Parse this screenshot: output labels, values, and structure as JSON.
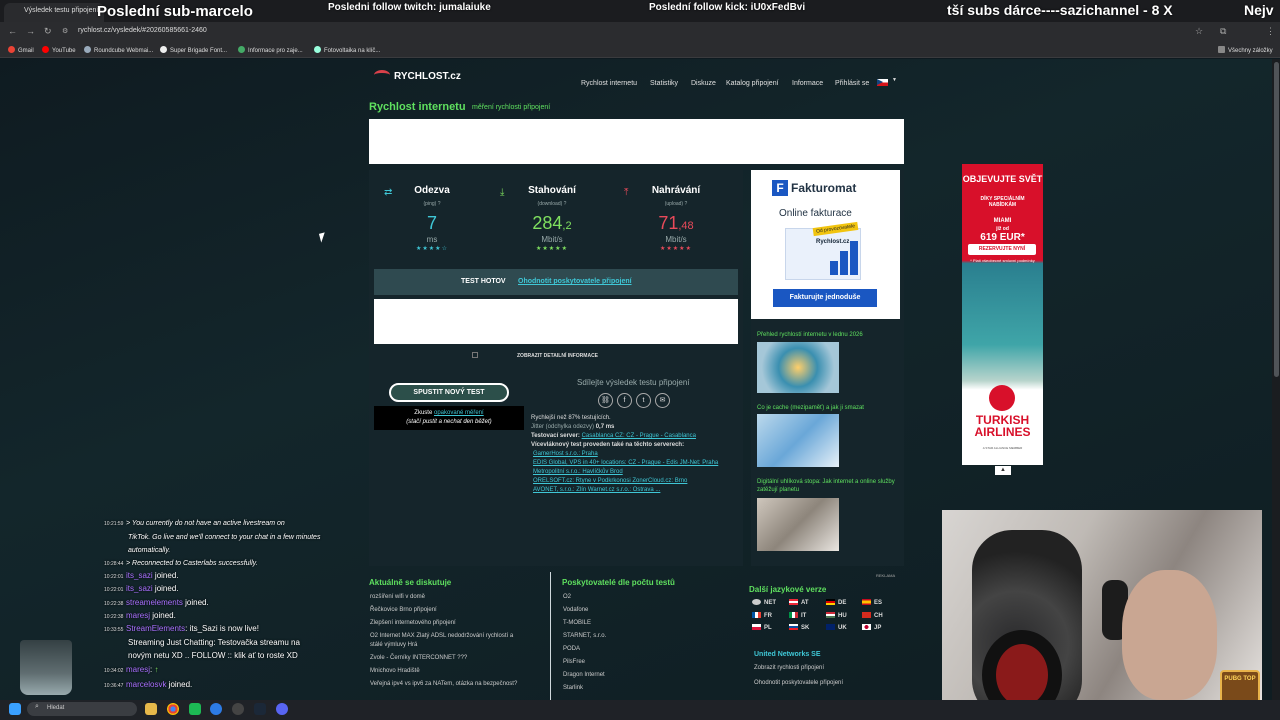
{
  "overlay": {
    "sub_marcel": "Poslední sub-marcelo",
    "follow_twitch": "Posledni follow twitch: jumalaiuke",
    "follow_kick": "Poslední follow kick: iU0xFedBvi",
    "subs_donor": "tší subs dárce----sazichannel - 8 X",
    "right_edge": "Nejv"
  },
  "browser": {
    "tab_title": "Výsledek testu připojení",
    "url": "rychlost.cz/vysledek/#20260585661-2460",
    "bookmarks": [
      "Gmail",
      "YouTube",
      "Roundcube Webmai...",
      "Super Brigade Font...",
      "Informace pro zaje...",
      "Fotovoltaika na klíč..."
    ],
    "all_bookmarks": "Všechny záložky"
  },
  "site": {
    "logo": "RYCHLOST.cz",
    "nav": [
      "Rychlost internetu",
      "Statistiky",
      "Diskuze",
      "Katalog připojení",
      "Informace",
      "Přihlásit se"
    ],
    "title": "Rychlost internetu",
    "subtitle": "měření rychlosti připojení"
  },
  "results": {
    "ping": {
      "label": "Odezva",
      "hint": "(ping) ?",
      "value": "7",
      "unit": "ms"
    },
    "download": {
      "label": "Stahování",
      "hint": "(download) ?",
      "value_int": "284",
      "value_dec": ",2",
      "unit": "Mbit/s"
    },
    "upload": {
      "label": "Nahrávání",
      "hint": "(upload) ?",
      "value_int": "71",
      "value_dec": ",48",
      "unit": "Mbit/s"
    },
    "done_label": "TEST HOTOV",
    "rate_link": "Ohodnotit poskytovatele připojení",
    "detail_label": "ZOBRAZIT DETAILNÍ INFORMACE",
    "new_test": "SPUSTIT NOVÝ TEST",
    "try_prefix": "Zkuste",
    "try_link": "opakované měření",
    "try_note": "(stačí pustit a nechat den běžet)",
    "share": "Sdílejte výsledek testu připojení",
    "faster": "Rychlejší než 87% testujících.",
    "jitter_label": "Jitter (odchylka odezvy)",
    "jitter_value": "0,7 ms",
    "server_label": "Testovací server:",
    "server_value": "Casablanca CZ: CZ - Prague - Casablanca",
    "multi_label": "Vícevláknový test proveden také na těchto serverech:",
    "servers_line1": "GamerHost s.r.o.: Praha",
    "servers_line2": "EDIS Global, VPS in 40+ locations: CZ - Prague - Edis   JM-Net: Praha",
    "servers_line3": "Metropolitní s.r.o.: Havlíčkův Brod",
    "servers_line4": "ORELSOFT.cz: Rtyne v Podkrkonosi   ZonerCloud.cz: Brno",
    "servers_line5": "AVONET, s.r.o.: Zlín   Warnet.cz s.r.o.: Ostrava ..."
  },
  "side": {
    "fk_logo": "Fakturomat",
    "fk_sub": "Online fakturace",
    "fk_tag": "Od provozovatele",
    "fk_chart": "Rychlost.cz",
    "fk_btn": "Fakturujte jednoduše",
    "art1": "Přehled rychlostí internetu v lednu 2026",
    "art2": "Co je cache (mezipaměť) a jak ji smazat",
    "art3": "Digitální uhlíková stopa: Jak internet a online služby zatěžují planetu"
  },
  "ad2": {
    "line1": "OBJEVUJTE SVĚT",
    "line2": "DÍKY SPECIÁLNÍM NABÍDKÁM",
    "city": "MIAMI",
    "from": "již od",
    "price": "619 EUR*",
    "btn": "REZERVUJTE NYNÍ",
    "note": "* Platí všeobecné smluvní podmínky",
    "brand": "TURKISH AIRLINES",
    "tagline": "A STAR ALLIANCE MEMBER"
  },
  "bottom": {
    "disc_title": "Aktuálně se diskutuje",
    "disc": [
      "rozšíření wifi v domě",
      "Řečkovice Brno připojení",
      "Zlepšení internetového připojení",
      "O2 Internet MAX Zlatý ADSL nedodržování rychlostí a",
      "stálé výmluvy Hrá",
      "Zvole - Černíky INTERCONNET ???",
      "Mnichovo Hradiště",
      "Veřejná ipv4 vs ipv6 za NATem, otázka na bezpečnost?"
    ],
    "prov_title": "Poskytovatelé dle počtu testů",
    "prov": [
      "O2",
      "Vodafone",
      "T-MOBILE",
      "STARNET, s.r.o.",
      "PODA",
      "PilsFree",
      "Dragon Internet",
      "Starlink"
    ],
    "lang_title": "Další jazykové verze",
    "langs": [
      "NET",
      "AT",
      "DE",
      "ES",
      "FR",
      "IT",
      "HU",
      "CH",
      "PL",
      "SK",
      "UK",
      "JP"
    ],
    "reklama": "REKLAMA",
    "un_title": "United Networks SE",
    "un_links": [
      "Zobrazit rychlosti připojení",
      "Ohodnotit poskytovatele připojení"
    ]
  },
  "chat": [
    {
      "time": "10:21:59",
      "user": "",
      "text": "> You currently do not have an active livestream on",
      "italic": true
    },
    {
      "time": "",
      "user": "",
      "text": "TikTok. Go live and we'll connect to your chat in a few minutes",
      "italic": true
    },
    {
      "time": "",
      "user": "",
      "text": "automatically.",
      "italic": true
    },
    {
      "time": "10:28:44",
      "user": "",
      "text": "> Reconnected to Casterlabs successfully.",
      "italic": true
    },
    {
      "time": "10:22:01",
      "user": "its_sazi",
      "text": " joined.",
      "italic": false
    },
    {
      "time": "10:22:01",
      "user": "its_sazi",
      "text": " joined.",
      "italic": false
    },
    {
      "time": "10:22:38",
      "user": "streamelements",
      "text": " joined.",
      "italic": false
    },
    {
      "time": "10:22:38",
      "user": "maresj",
      "text": " joined.",
      "italic": false
    },
    {
      "time": "10:33:55",
      "user": "StreamElements",
      "text": ": its_Sazi is now live!",
      "italic": false
    },
    {
      "time": "",
      "user": "",
      "text": "Streaming Just Chatting: Testovačka streamu na",
      "italic": false
    },
    {
      "time": "",
      "user": "",
      "text": "novým netu XD .. FOLLOW :: klik ať to roste XD",
      "italic": false
    },
    {
      "time": "10:34:02",
      "user": "maresj",
      "text": ":",
      "italic": false
    },
    {
      "time": "10:36:47",
      "user": "marcelosvk",
      "text": " joined.",
      "italic": false
    }
  ],
  "webcam": {
    "badge": "PUBG TOP"
  },
  "taskbar": {
    "search": "Hledat"
  },
  "colors": {
    "accent_green": "#5fe05f",
    "link_cyan": "#3fc7d6",
    "ping": "#3fc7d6",
    "download": "#7fe05f",
    "upload": "#e84a5a",
    "brand_blue": "#1a57c2",
    "airline_red": "#d8102a"
  }
}
